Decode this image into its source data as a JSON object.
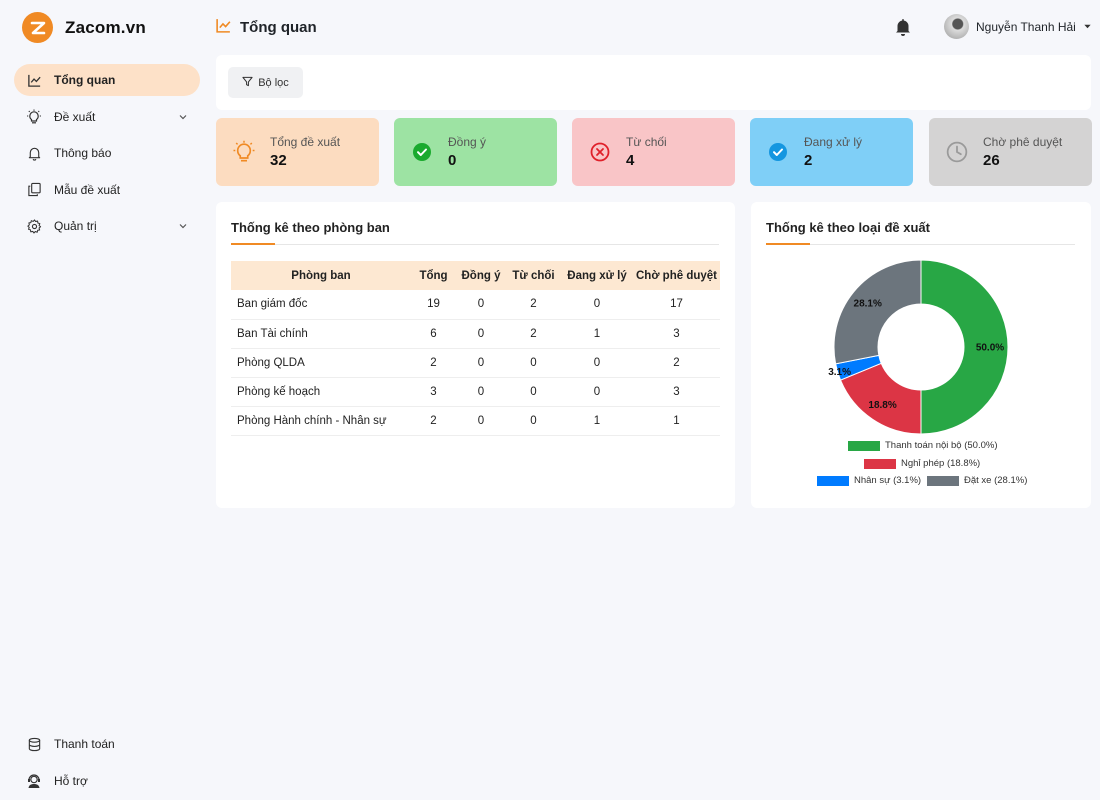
{
  "brand": {
    "name": "Zacom.vn"
  },
  "sidebar": {
    "items": [
      {
        "label": "Tổng quan",
        "icon": "chart-line-icon",
        "active": true
      },
      {
        "label": "Đề xuất",
        "icon": "lightbulb-icon",
        "has_children": true
      },
      {
        "label": "Thông báo",
        "icon": "bell-icon"
      },
      {
        "label": "Mẫu đề xuất",
        "icon": "copy-icon"
      },
      {
        "label": "Quản trị",
        "icon": "gear-icon",
        "has_children": true
      }
    ],
    "bottom": [
      {
        "label": "Thanh toán",
        "icon": "database-icon"
      },
      {
        "label": "Hỗ trợ",
        "icon": "headset-icon"
      }
    ]
  },
  "header": {
    "title": "Tổng quan",
    "user_name": "Nguyễn Thanh Hải"
  },
  "filter": {
    "label": "Bộ lọc"
  },
  "stats": [
    {
      "label": "Tổng đề xuất",
      "value": "32",
      "bg": "#fcdcc0",
      "color": "#f08a24",
      "icon": "lightbulb-icon"
    },
    {
      "label": "Đồng ý",
      "value": "0",
      "bg": "#9de3a3",
      "color": "#1aaa2e",
      "icon": "check-circle-icon"
    },
    {
      "label": "Từ chối",
      "value": "4",
      "bg": "#f9c5c7",
      "color": "#e0202a",
      "icon": "x-circle-icon"
    },
    {
      "label": "Đang xử lý",
      "value": "2",
      "bg": "#7fcff7",
      "color": "#1496e0",
      "icon": "check-circle-icon"
    },
    {
      "label": "Chờ phê duyệt",
      "value": "26",
      "bg": "#d4d3d3",
      "color": "#9a9a9a",
      "icon": "clock-icon"
    }
  ],
  "dept_panel": {
    "title": "Thống kê theo phòng ban",
    "columns": [
      "Phòng ban",
      "Tổng",
      "Đồng ý",
      "Từ chối",
      "Đang xử lý",
      "Chờ phê duyệt"
    ],
    "rows": [
      [
        "Ban giám đốc",
        "19",
        "0",
        "2",
        "0",
        "17"
      ],
      [
        "Ban Tài chính",
        "6",
        "0",
        "2",
        "1",
        "3"
      ],
      [
        "Phòng QLDA",
        "2",
        "0",
        "0",
        "0",
        "2"
      ],
      [
        "Phòng kế hoạch",
        "3",
        "0",
        "0",
        "0",
        "3"
      ],
      [
        "Phòng Hành chính - Nhân sự",
        "2",
        "0",
        "0",
        "1",
        "1"
      ]
    ]
  },
  "type_panel": {
    "title": "Thống kê theo loại đề xuất"
  },
  "chart_data": {
    "type": "pie",
    "donut": true,
    "slices": [
      {
        "name": "Thanh toán nội bộ",
        "value": 50.0,
        "label": "50.0%",
        "legend": "Thanh toán nội bộ (50.0%)",
        "color": "#28a745"
      },
      {
        "name": "Nghỉ phép",
        "value": 18.8,
        "label": "18.8%",
        "legend": "Nghỉ phép (18.8%)",
        "color": "#dc3545"
      },
      {
        "name": "Nhân sự",
        "value": 3.1,
        "label": "3.1%",
        "legend": "Nhân sự (3.1%)",
        "color": "#007bff"
      },
      {
        "name": "Đặt xe",
        "value": 28.1,
        "label": "28.1%",
        "legend": "Đặt xe (28.1%)",
        "color": "#6c757d"
      }
    ],
    "legend_position": "bottom"
  }
}
